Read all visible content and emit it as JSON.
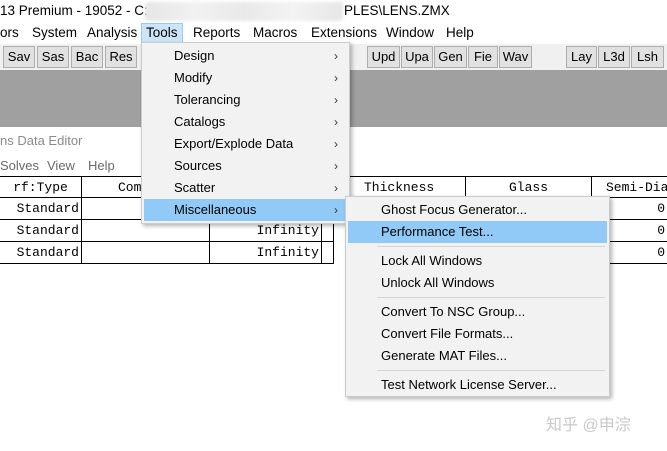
{
  "window": {
    "title_left": "13 Premium - 19052 - C:",
    "title_right": "PLES\\LENS.ZMX"
  },
  "menubar": [
    "ors",
    "System",
    "Analysis",
    "Tools",
    "Reports",
    "Macros",
    "Extensions",
    "Window",
    "Help"
  ],
  "toolbar": {
    "left": [
      "Sav",
      "Sas",
      "Bac",
      "Res"
    ],
    "middle": [
      "Upd",
      "Upa",
      "Gen",
      "Fie",
      "Wav"
    ],
    "right": [
      "Lay",
      "L3d",
      "Lsh"
    ]
  },
  "editor": {
    "title": "ns Data Editor",
    "menu": [
      "Solves",
      "View",
      "Help"
    ],
    "columns": [
      "rf:Type",
      "Com",
      "Thickness",
      "Glass",
      "Semi-Dia"
    ],
    "rows": [
      {
        "type": "Standard",
        "radius": "",
        "semi": "0"
      },
      {
        "type": "Standard",
        "radius": "Infinity",
        "semi": "0"
      },
      {
        "type": "Standard",
        "radius": "Infinity",
        "semi": "0"
      }
    ]
  },
  "tools_menu": {
    "items": [
      "Design",
      "Modify",
      "Tolerancing",
      "Catalogs",
      "Export/Explode Data",
      "Sources",
      "Scatter",
      "Miscellaneous"
    ],
    "arrow": "›"
  },
  "misc_menu": {
    "group1": [
      "Ghost Focus Generator...",
      "Performance Test..."
    ],
    "group2": [
      "Lock All Windows",
      "Unlock All Windows"
    ],
    "group3": [
      "Convert To NSC Group...",
      "Convert File Formats...",
      "Generate MAT Files..."
    ],
    "group4": [
      "Test Network License Server..."
    ]
  },
  "watermark": "知乎 @申淙"
}
